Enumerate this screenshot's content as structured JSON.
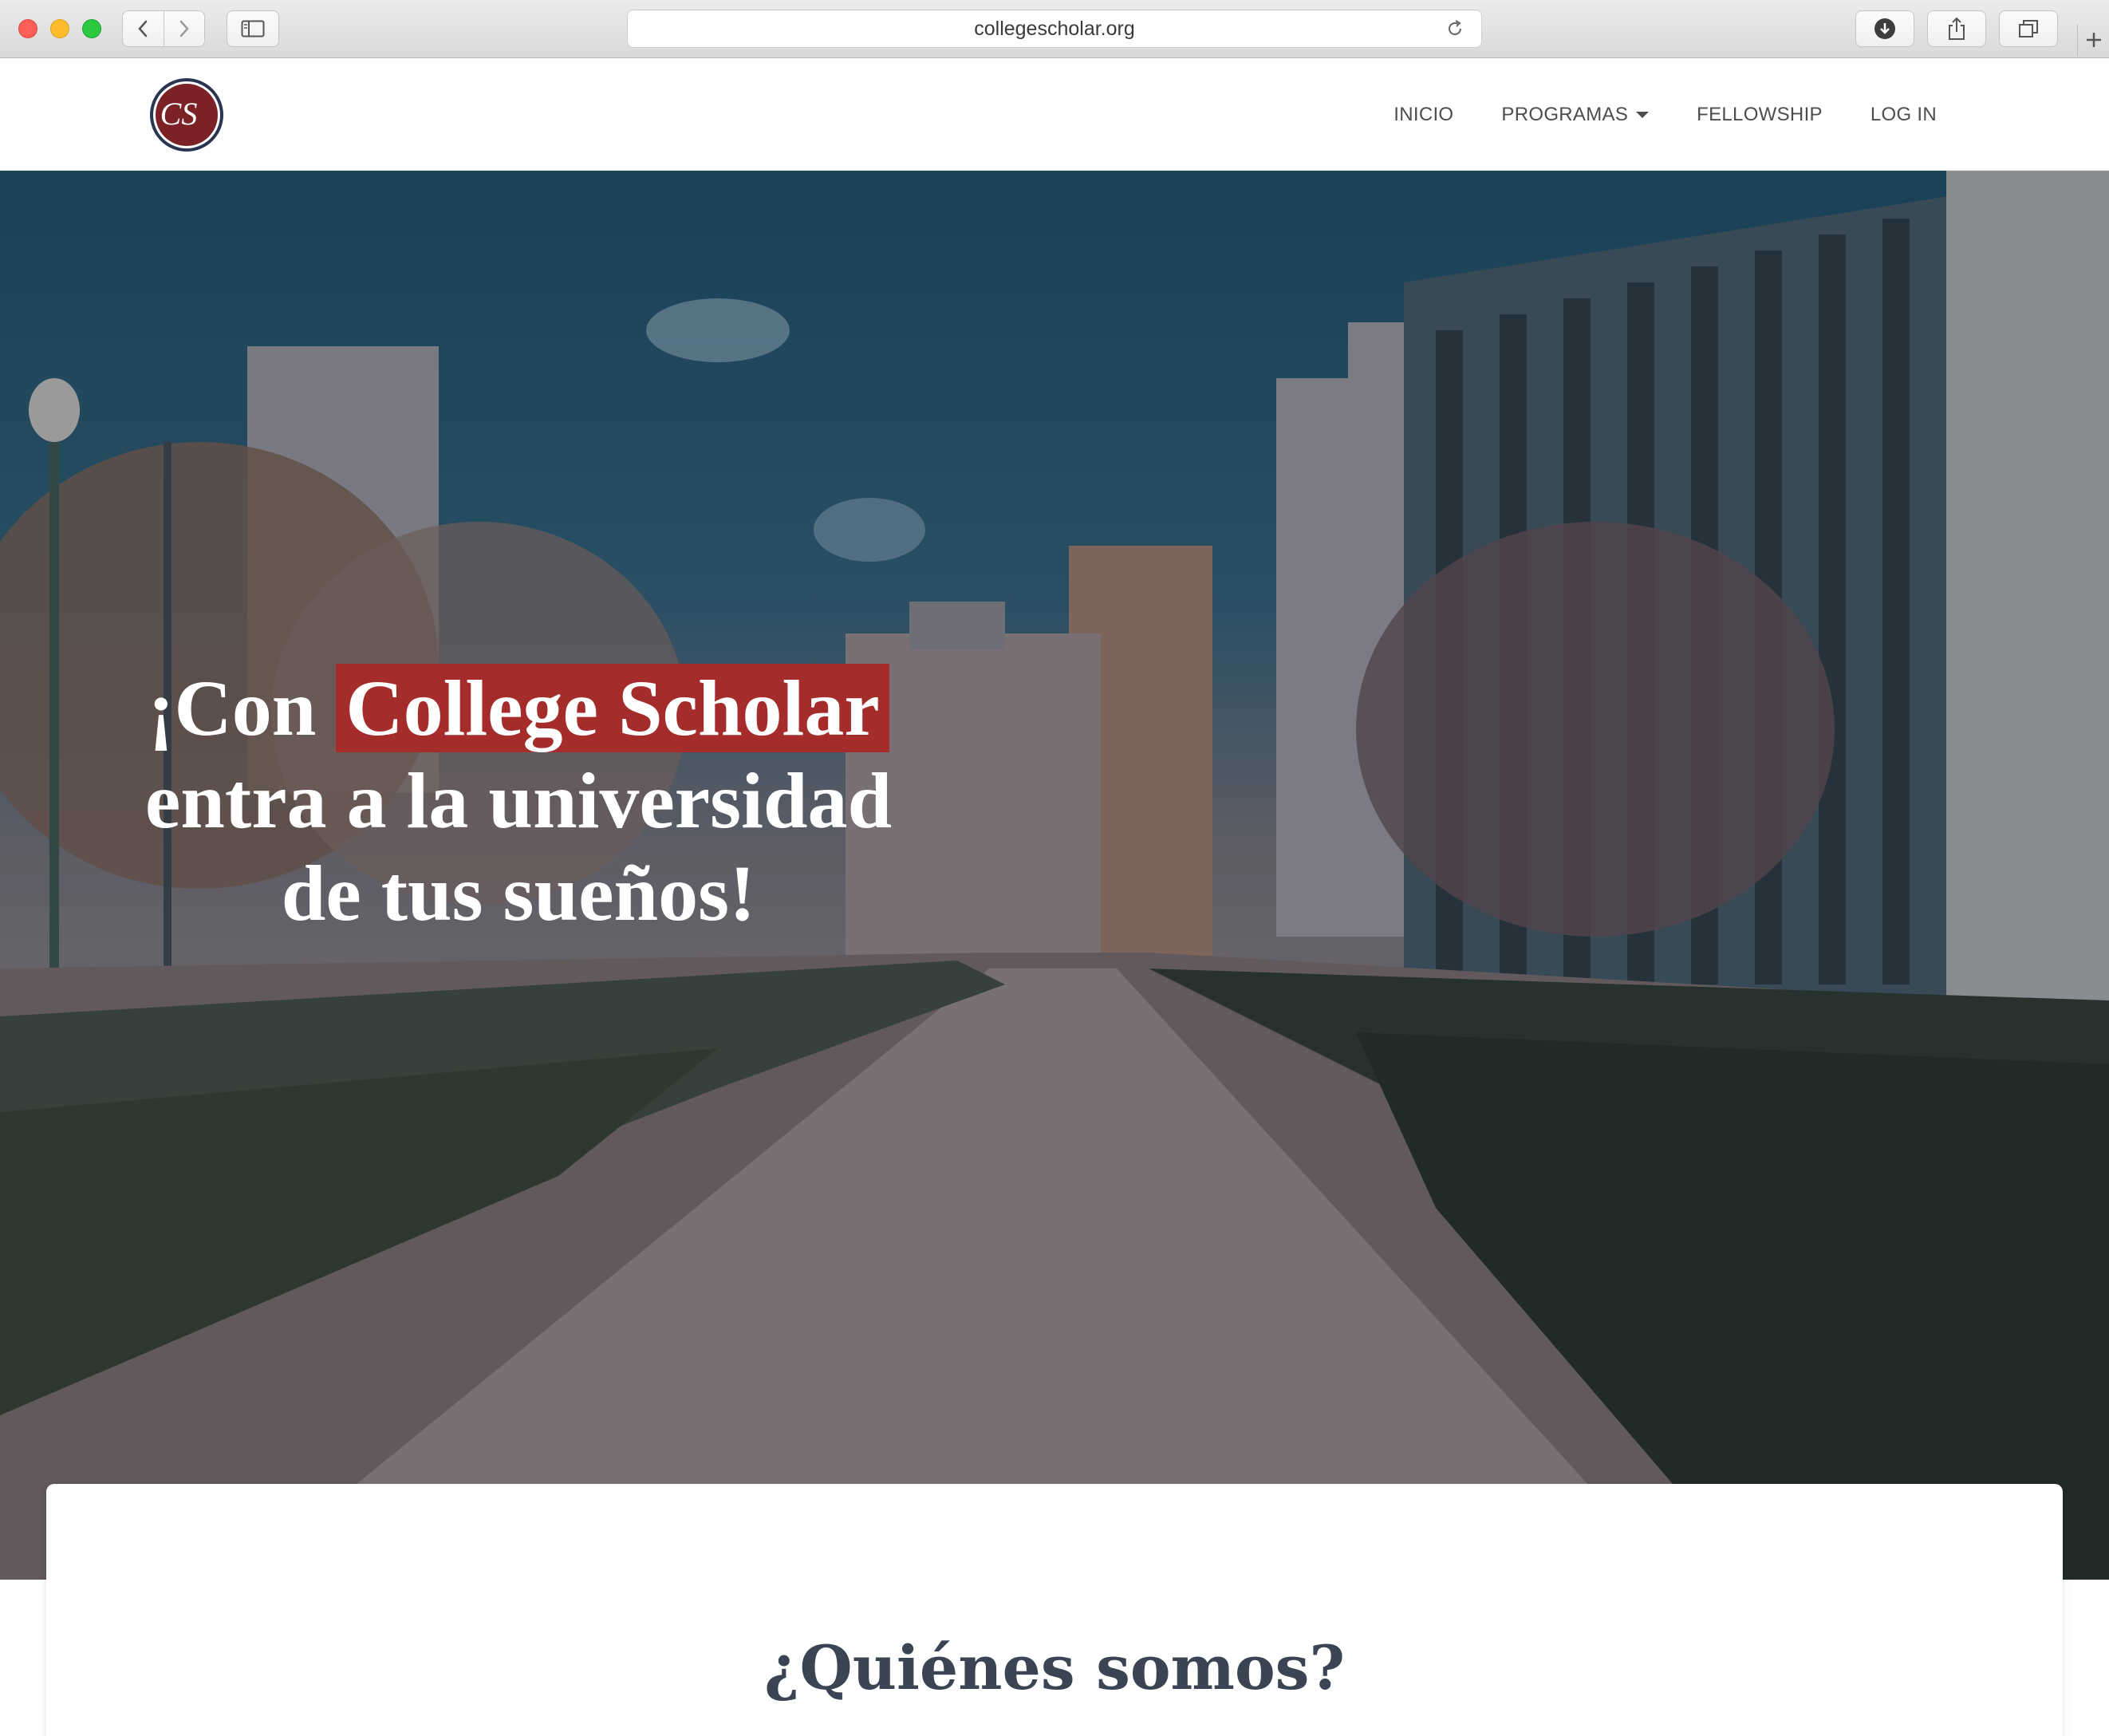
{
  "browser": {
    "url": "collegescholar.org",
    "icons": {
      "back": "chevron-left-icon",
      "forward": "chevron-right-icon",
      "sidebar": "sidebar-icon",
      "reload": "reload-icon",
      "downloads": "download-icon",
      "share": "share-icon",
      "tabs": "tabs-icon",
      "new_tab": "plus-icon"
    }
  },
  "header": {
    "logo_text": "CS",
    "nav": [
      {
        "label": "INICIO"
      },
      {
        "label": "PROGRAMAS",
        "has_dropdown": true
      },
      {
        "label": "FELLOWSHIP"
      },
      {
        "label": "LOG IN"
      }
    ]
  },
  "hero": {
    "title_before": "¡Con ",
    "title_highlight": "College Scholar",
    "title_after": "entra a la universidad de tus sueños!"
  },
  "about": {
    "title": "¿Quiénes somos?"
  },
  "colors": {
    "brand_red": "#a42d2b",
    "logo_red": "#7a2226",
    "logo_ring": "#2a3552",
    "heading": "#3b4453",
    "nav_text": "#4d4d4d"
  }
}
